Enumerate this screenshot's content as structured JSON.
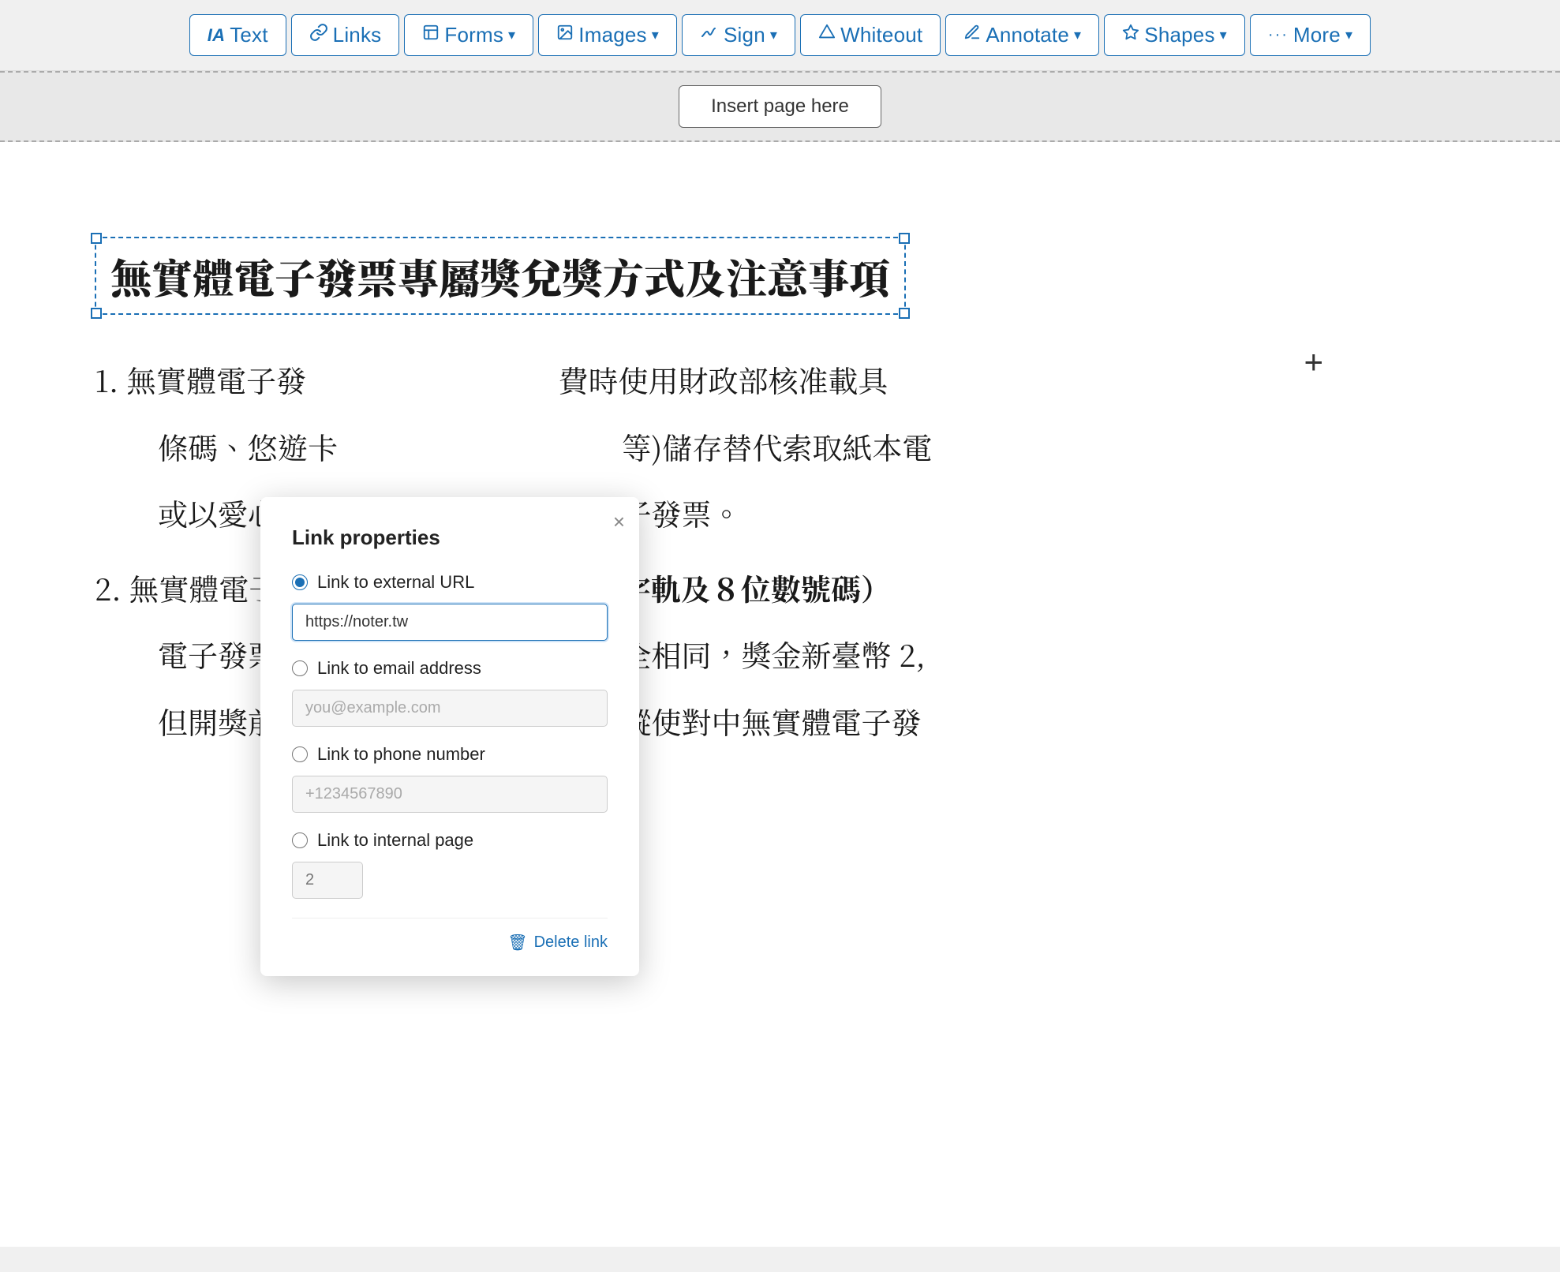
{
  "toolbar": {
    "buttons": [
      {
        "id": "ia-text",
        "icon": "IA",
        "label": "Text",
        "hasDropdown": false
      },
      {
        "id": "links",
        "icon": "🔗",
        "label": "Links",
        "hasDropdown": false
      },
      {
        "id": "forms",
        "icon": "📋",
        "label": "Forms",
        "hasDropdown": true
      },
      {
        "id": "images",
        "icon": "🖼",
        "label": "Images",
        "hasDropdown": true
      },
      {
        "id": "sign",
        "icon": "✒",
        "label": "Sign",
        "hasDropdown": true
      },
      {
        "id": "whiteout",
        "icon": "◇",
        "label": "Whiteout",
        "hasDropdown": false
      },
      {
        "id": "annotate",
        "icon": "✏",
        "label": "Annotate",
        "hasDropdown": true
      },
      {
        "id": "shapes",
        "icon": "⬡",
        "label": "Shapes",
        "hasDropdown": true
      },
      {
        "id": "more",
        "icon": "···",
        "label": "More",
        "hasDropdown": true
      }
    ]
  },
  "insert_page_label": "Insert page here",
  "heading": "無實體電子發票專屬獎兌獎方式及注意事項",
  "body_lines": [
    {
      "prefix": "1. 無實體電子發",
      "suffix": "費時使用財政部核准載具"
    },
    {
      "line2": "條碼、悠遊卡",
      "suffix2": "等)儲存替代索取紙本電"
    },
    {
      "line3": "或以愛心碼扑",
      "suffix3": "子發票。"
    },
    {
      "prefix2": "2. 無實體電子發",
      "bold_suffix": "英文字軌及８位數號碼）"
    },
    {
      "line4": "電子發票專屬",
      "suffix4": "全相同，獎金新臺幣 2,"
    },
    {
      "line5": "但開獎前列冊",
      "suffix5": "縱使對中無實體電子發"
    }
  ],
  "dialog": {
    "title": "Link properties",
    "close_label": "×",
    "options": [
      {
        "id": "external-url",
        "label": "Link to external URL",
        "checked": true
      },
      {
        "id": "email",
        "label": "Link to email address",
        "checked": false
      },
      {
        "id": "phone",
        "label": "Link to phone number",
        "checked": false
      },
      {
        "id": "internal-page",
        "label": "Link to internal page",
        "checked": false
      }
    ],
    "external_url_value": "https://noter.tw",
    "email_placeholder": "you@example.com",
    "phone_placeholder": "+1234567890",
    "page_number_placeholder": "2",
    "delete_link_label": "Delete link"
  }
}
